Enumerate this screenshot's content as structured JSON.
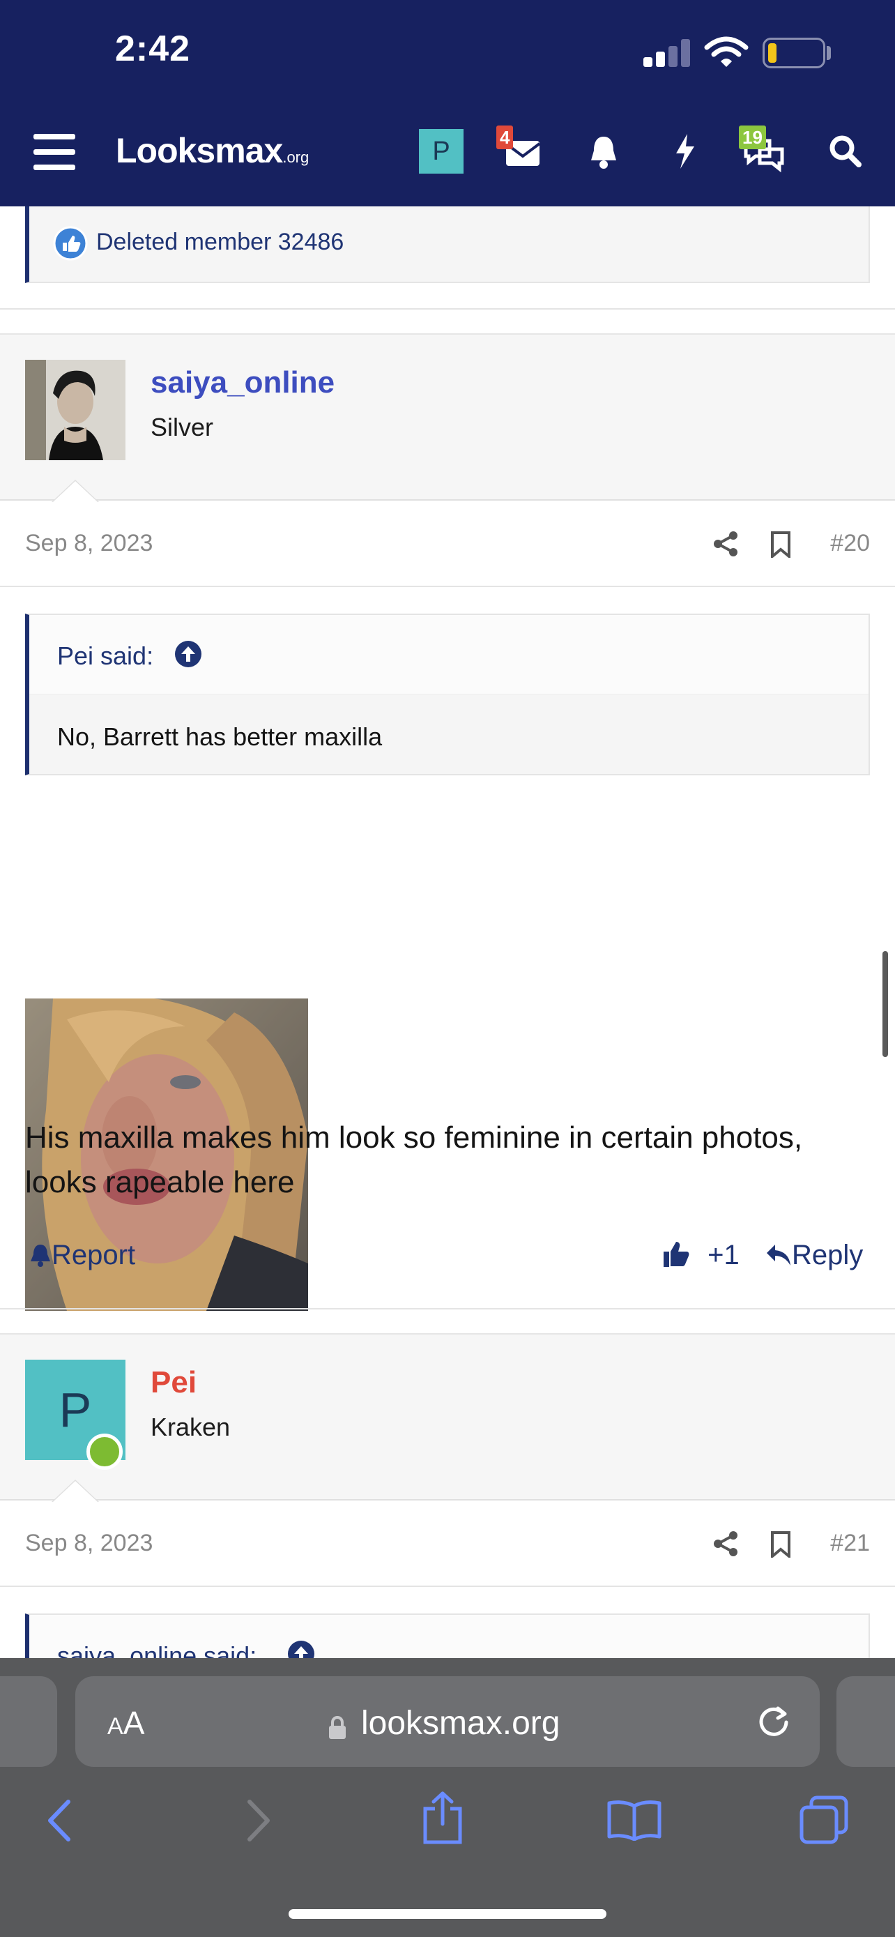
{
  "status_bar": {
    "time": "2:42"
  },
  "header": {
    "logo_main": "Looksmax",
    "logo_suffix": ".org",
    "user_initial": "P",
    "inbox_badge": "4",
    "alerts_badge": "19"
  },
  "previous_post": {
    "reaction_text": "Deleted member 32486"
  },
  "post_20": {
    "author": "saiya_online",
    "author_color": "#3d4dbf",
    "user_title": "Silver",
    "date": "Sep 8, 2023",
    "post_number": "#20",
    "quote_header": "Pei said:",
    "quote_body": "No, Barrett has better maxilla",
    "body_text": "His maxilla makes him look so feminine in certain photos, looks rapeable here",
    "report_label": "Report",
    "reaction_count": "+1",
    "reply_label": "Reply"
  },
  "post_21": {
    "author": "Pei",
    "author_color": "#e0493a",
    "author_initial": "P",
    "user_title": "Kraken",
    "date": "Sep 8, 2023",
    "post_number": "#21",
    "quote_header": "saiya_online said:"
  },
  "browser": {
    "aa_label_small": "A",
    "aa_label_large": "A",
    "url": "looksmax.org"
  },
  "colors": {
    "header_bg": "#172160",
    "accent": "#1f3474",
    "safari_bar": "#58595b"
  }
}
